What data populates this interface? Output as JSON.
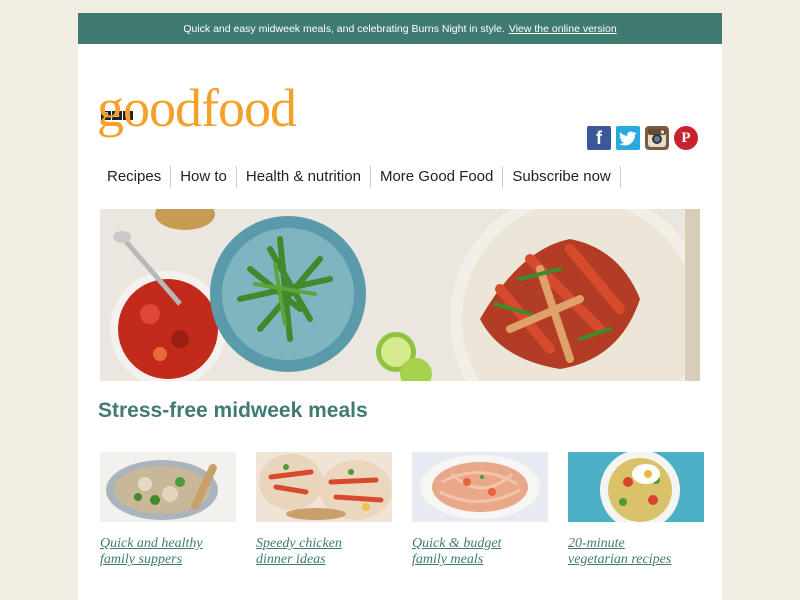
{
  "preheader": {
    "text": "Quick and easy midweek meals, and celebrating Burns Night in style.",
    "link": "View the online version"
  },
  "brand": {
    "bbc": [
      "B",
      "B",
      "C"
    ],
    "logo": "goodfood",
    "logo_color": "#f2a12a",
    "accent": "#3f7b71"
  },
  "social": [
    {
      "icon": "facebook-icon",
      "glyph": "f"
    },
    {
      "icon": "twitter-icon",
      "glyph": "t"
    },
    {
      "icon": "instagram-icon",
      "glyph": ""
    },
    {
      "icon": "pinterest-icon",
      "glyph": "P"
    }
  ],
  "nav": [
    "Recipes",
    "How to",
    "Health & nutrition",
    "More Good Food",
    "Subscribe now"
  ],
  "section": {
    "title": "Stress-free midweek meals"
  },
  "cards": [
    {
      "line1": "Quick and healthy",
      "line2": "family suppers"
    },
    {
      "line1": "Speedy chicken",
      "line2": "dinner ideas"
    },
    {
      "line1": "Quick & budget",
      "line2": "family meals"
    },
    {
      "line1": "20-minute",
      "line2": "vegetarian recipes"
    }
  ]
}
